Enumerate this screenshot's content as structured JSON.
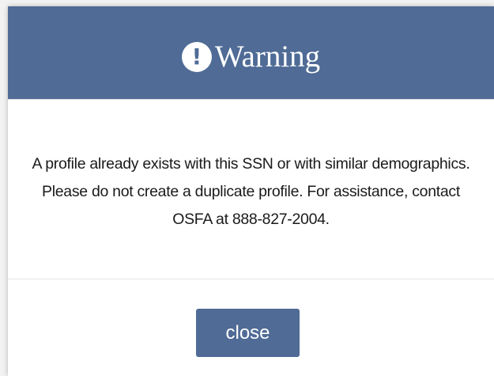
{
  "dialog": {
    "title": "Warning",
    "icon": "exclamation-circle-icon",
    "message": "A profile already exists with this SSN or with similar demographics. Please do not create a duplicate profile. For assistance, contact OSFA at 888-827-2004.",
    "close_label": "close"
  },
  "colors": {
    "header_background": "#4f6b96",
    "button_background": "#4f6b96",
    "body_background": "#ffffff",
    "text": "#1a1a1a"
  }
}
